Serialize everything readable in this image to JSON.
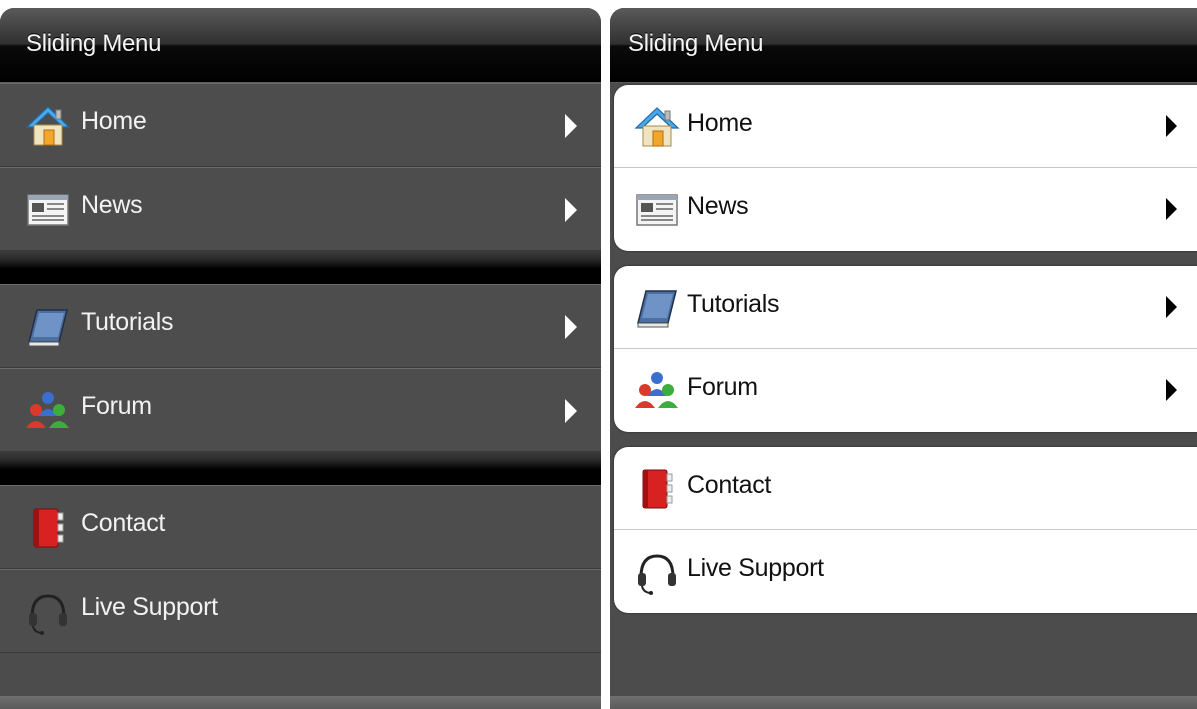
{
  "left_panel": {
    "title": "Sliding Menu",
    "items": [
      {
        "label": "Home",
        "icon": "home-icon"
      },
      {
        "label": "News",
        "icon": "news-icon"
      },
      {
        "label": "Tutorials",
        "icon": "book-icon"
      },
      {
        "label": "Forum",
        "icon": "users-icon"
      },
      {
        "label": "Contact",
        "icon": "address-book-icon"
      },
      {
        "label": "Live Support",
        "icon": "headset-icon"
      }
    ]
  },
  "right_panel": {
    "title": "Sliding Menu",
    "items": [
      {
        "label": "Home",
        "icon": "home-icon"
      },
      {
        "label": "News",
        "icon": "news-icon"
      },
      {
        "label": "Tutorials",
        "icon": "book-icon"
      },
      {
        "label": "Forum",
        "icon": "users-icon"
      },
      {
        "label": "Contact",
        "icon": "address-book-icon"
      },
      {
        "label": "Live Support",
        "icon": "headset-icon"
      }
    ]
  },
  "colors": {
    "dark_row": "#4d4d4d",
    "title_bar": "#000000",
    "light_row": "#ffffff"
  }
}
